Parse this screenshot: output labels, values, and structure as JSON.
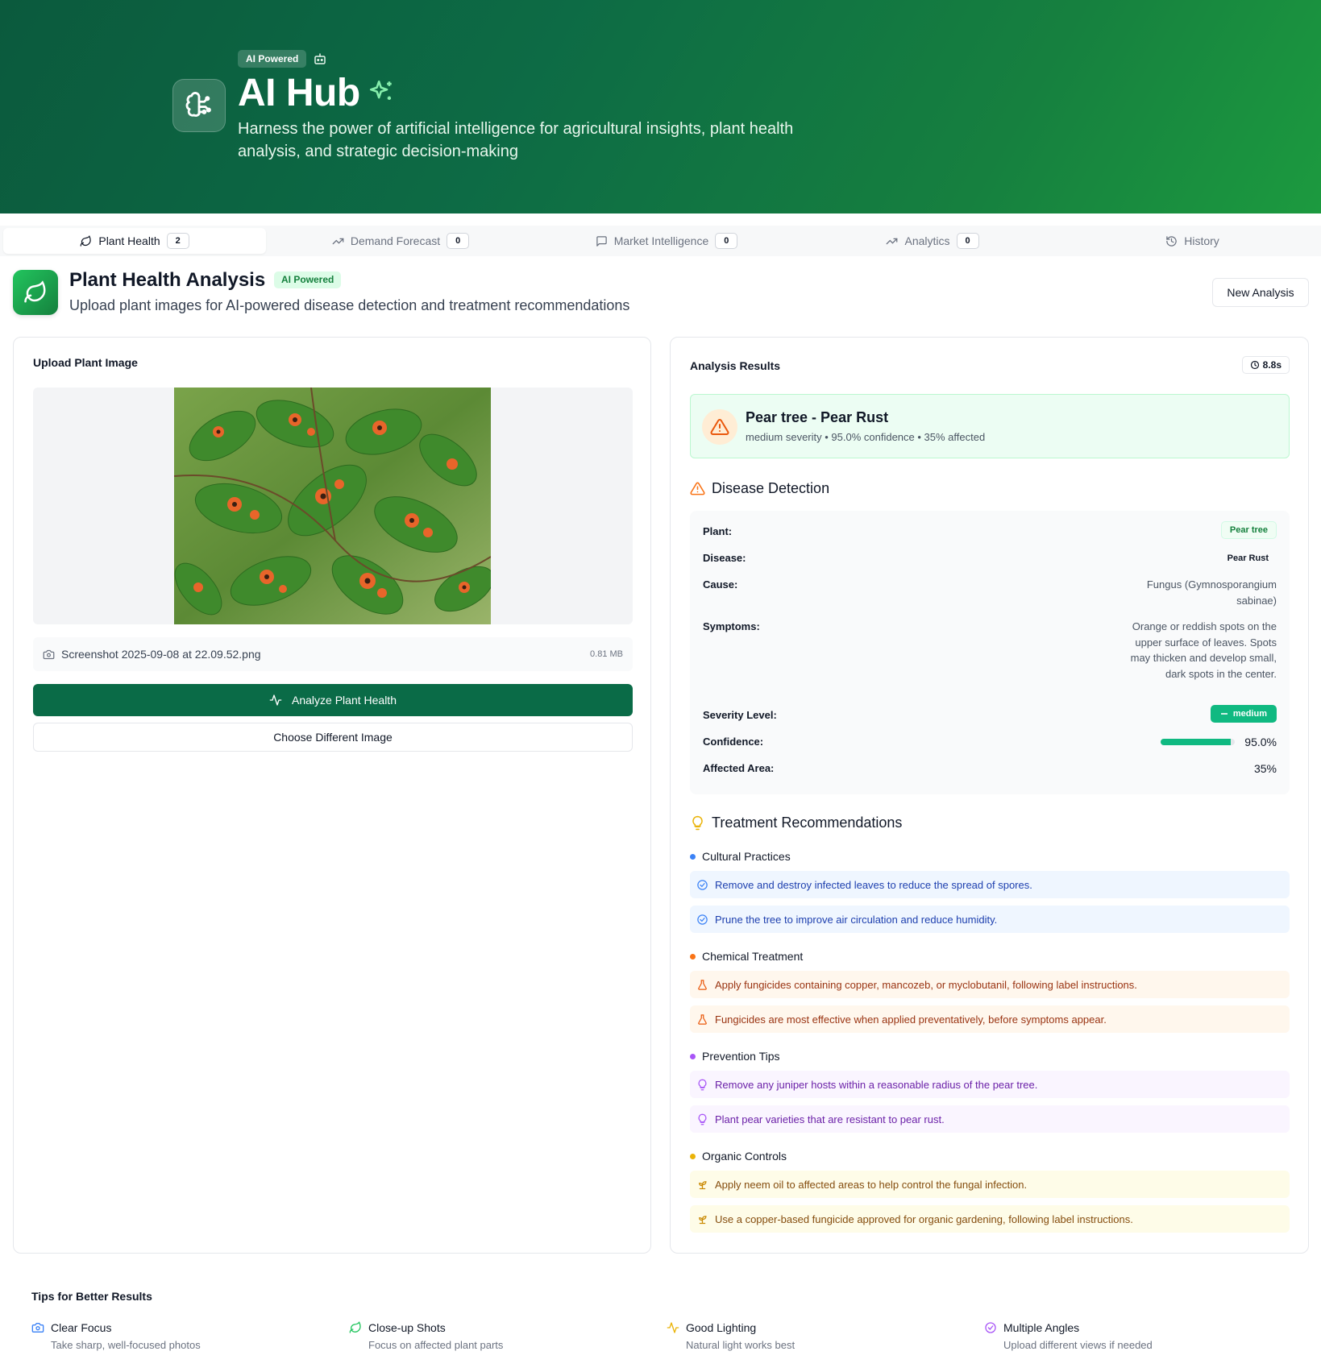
{
  "hero": {
    "badge": "AI Powered",
    "title": "AI Hub",
    "subtitle": "Harness the power of artificial intelligence for agricultural insights, plant health analysis, and strategic decision-making",
    "background": "#0d6b45"
  },
  "tabs": [
    {
      "label": "Plant Health",
      "count": "2",
      "icon": "leaf-icon",
      "active": true
    },
    {
      "label": "Demand Forecast",
      "count": "0",
      "icon": "trend-up-icon"
    },
    {
      "label": "Market Intelligence",
      "count": "0",
      "icon": "chat-icon"
    },
    {
      "label": "Analytics",
      "count": "0",
      "icon": "trend-up-icon"
    },
    {
      "label": "History",
      "icon": "history-icon"
    }
  ],
  "page": {
    "title": "Plant Health Analysis",
    "badge": "AI Powered",
    "subtitle": "Upload plant images for AI-powered disease detection and treatment recommendations",
    "new_button": "New Analysis"
  },
  "upload": {
    "heading": "Upload Plant Image",
    "file_name": "Screenshot 2025-09-08 at 22.09.52.png",
    "file_size": "0.81 MB",
    "analyze_button": "Analyze Plant Health",
    "choose_button": "Choose Different Image",
    "primary_color": "#0a6b47"
  },
  "results": {
    "heading": "Analysis Results",
    "time": "8.8s",
    "summary_title": "Pear tree - Pear Rust",
    "summary_sub": "medium severity • 95.0% confidence • 35% affected",
    "detection_heading": "Disease Detection",
    "labels": {
      "plant": "Plant:",
      "disease": "Disease:",
      "cause": "Cause:",
      "symptoms": "Symptoms:",
      "severity": "Severity Level:",
      "confidence": "Confidence:",
      "area": "Affected Area:"
    },
    "plant": "Pear tree",
    "disease": "Pear Rust",
    "cause": "Fungus (Gymnosporangium sabinae)",
    "symptoms": "Orange or reddish spots on the upper surface of leaves. Spots may thicken and develop small, dark spots in the center.",
    "severity": "medium",
    "confidence": "95.0%",
    "confidence_fraction": 0.95,
    "affected_area": "35%"
  },
  "treatment": {
    "heading": "Treatment Recommendations",
    "cultural": {
      "title": "Cultural Practices",
      "color": "#3b82f6",
      "items": [
        "Remove and destroy infected leaves to reduce the spread of spores.",
        "Prune the tree to improve air circulation and reduce humidity."
      ]
    },
    "chemical": {
      "title": "Chemical Treatment",
      "color": "#f97316",
      "items": [
        "Apply fungicides containing copper, mancozeb, or myclobutanil, following label instructions.",
        "Fungicides are most effective when applied preventatively, before symptoms appear."
      ]
    },
    "prevention": {
      "title": "Prevention Tips",
      "color": "#a855f7",
      "items": [
        "Remove any juniper hosts within a reasonable radius of the pear tree.",
        "Plant pear varieties that are resistant to pear rust."
      ]
    },
    "organic": {
      "title": "Organic Controls",
      "color": "#eab308",
      "items": [
        "Apply neem oil to affected areas to help control the fungal infection.",
        "Use a copper-based fungicide approved for organic gardening, following label instructions."
      ]
    }
  },
  "tips": {
    "heading": "Tips for Better Results",
    "items": [
      {
        "title": "Clear Focus",
        "desc": "Take sharp, well-focused photos",
        "icon": "camera-icon"
      },
      {
        "title": "Close-up Shots",
        "desc": "Focus on affected plant parts",
        "icon": "leaf-icon"
      },
      {
        "title": "Good Lighting",
        "desc": "Natural light works best",
        "icon": "pulse-icon"
      },
      {
        "title": "Multiple Angles",
        "desc": "Upload different views if needed",
        "icon": "check-circle-icon"
      }
    ]
  }
}
